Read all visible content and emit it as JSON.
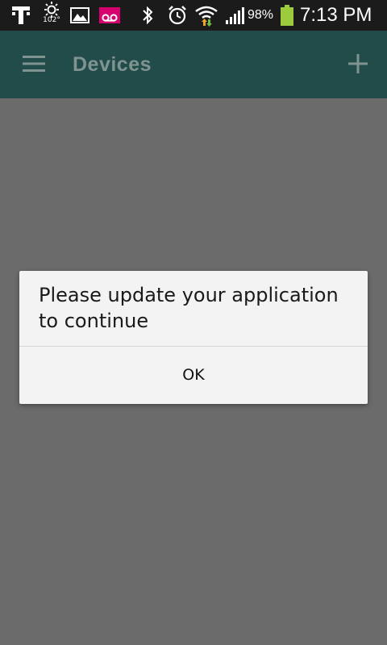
{
  "status_bar": {
    "carrier_icon": "t-mobile-icon",
    "weather_icon": "sun-icon",
    "temperature": "102°",
    "gallery_icon": "image-icon",
    "voicemail_icon": "voicemail-icon",
    "bluetooth_icon": "bluetooth-icon",
    "alarm_icon": "alarm-icon",
    "wifi_icon": "wifi-icon",
    "signal_icon": "signal-icon",
    "battery_percent": "98%",
    "battery_icon": "battery-icon",
    "time": "7:13 PM"
  },
  "app_bar": {
    "menu_icon": "hamburger-menu-icon",
    "title": "Devices",
    "add_icon": "plus-icon"
  },
  "dialog": {
    "message": "Please update your application to continue",
    "ok_label": "OK"
  },
  "colors": {
    "status_bar_bg": "#1b1b1b",
    "app_bar_bg": "#214c4a",
    "app_title": "#7f9391",
    "overlay_bg": "#6b6b6b",
    "dialog_bg": "#f3f3f3",
    "battery_green": "#9ccc3c",
    "voicemail_pink": "#d6006e"
  }
}
